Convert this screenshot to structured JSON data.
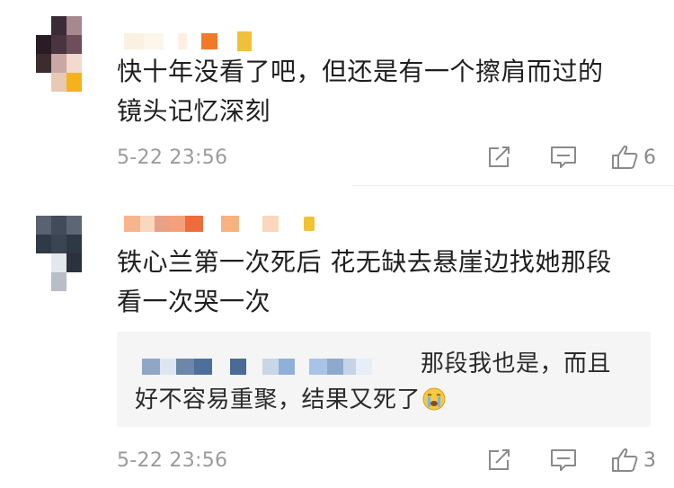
{
  "comments": [
    {
      "text": "快十年没看了吧，但还是有一个擦肩而过的\n镜头记忆深刻",
      "timestamp": "5-22 23:56",
      "actions": {
        "share_icon": "share-icon",
        "reply_icon": "comment-icon",
        "like_icon": "thumbs-up-icon",
        "like_count": "6"
      },
      "username_obscured": true,
      "avatar_obscured": true
    },
    {
      "text": "铁心兰第一次死后 花无缺去悬崖边找她那段\n看一次哭一次",
      "timestamp": "5-22 23:56",
      "actions": {
        "share_icon": "share-icon",
        "reply_icon": "comment-icon",
        "like_icon": "thumbs-up-icon",
        "like_count": "3"
      },
      "username_obscured": true,
      "avatar_obscured": true,
      "reply": {
        "text_line1": "那段我也是，而且",
        "text_line2": "好不容易重聚，结果又死了",
        "emoji": "crying-face-emoji",
        "username_obscured": true
      }
    }
  ],
  "colors": {
    "timestamp": "#9b9b9b",
    "reply_background": "#f5f5f5",
    "icon": "#8a8a8a"
  }
}
